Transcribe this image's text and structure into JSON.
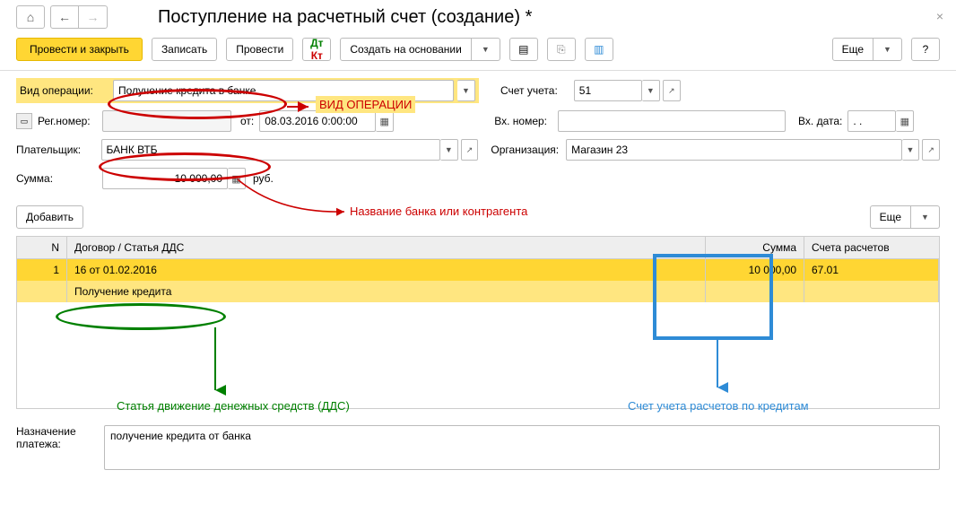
{
  "header": {
    "title": "Поступление на расчетный счет (создание) *"
  },
  "toolbar": {
    "post_and_close": "Провести и закрыть",
    "write": "Записать",
    "post": "Провести",
    "create_based_on": "Создать на основании",
    "more": "Еще"
  },
  "annotations": {
    "op_type_caption": "ВИД ОПЕРАЦИИ",
    "bank_caption": "Название банка или контрагента",
    "dds_caption": "Статья движение денежных средств (ДДС)",
    "acct_caption": "Счет учета расчетов по кредитам"
  },
  "form": {
    "op_type_label": "Вид операции:",
    "op_type_value": "Получение кредита в банке",
    "acct_label": "Счет учета:",
    "acct_value": "51",
    "reg_label": "Рег.номер:",
    "reg_value": "",
    "reg_from": "от:",
    "reg_date": "08.03.2016  0:00:00",
    "in_number_label": "Вх. номер:",
    "in_number_value": "",
    "in_date_label": "Вх. дата:",
    "in_date_value": " .  .    ",
    "payer_label": "Плательщик:",
    "payer_value": "БАНК ВТБ",
    "org_label": "Организация:",
    "org_value": "Магазин 23",
    "amount_label": "Сумма:",
    "amount_value": "10 000,00",
    "amount_currency": "руб."
  },
  "table": {
    "add_button": "Добавить",
    "more": "Еще",
    "headers": {
      "n": "N",
      "contract": "Договор / Статья ДДС",
      "sum": "Сумма",
      "accounts": "Счета расчетов"
    },
    "rows": [
      {
        "n": "1",
        "contract_top": "16 от 01.02.2016",
        "contract_bottom": "Получение кредита",
        "sum": "10 000,00",
        "account": "67.01"
      }
    ]
  },
  "purpose": {
    "label": "Назначение платежа:",
    "value": "получение кредита от банка"
  }
}
